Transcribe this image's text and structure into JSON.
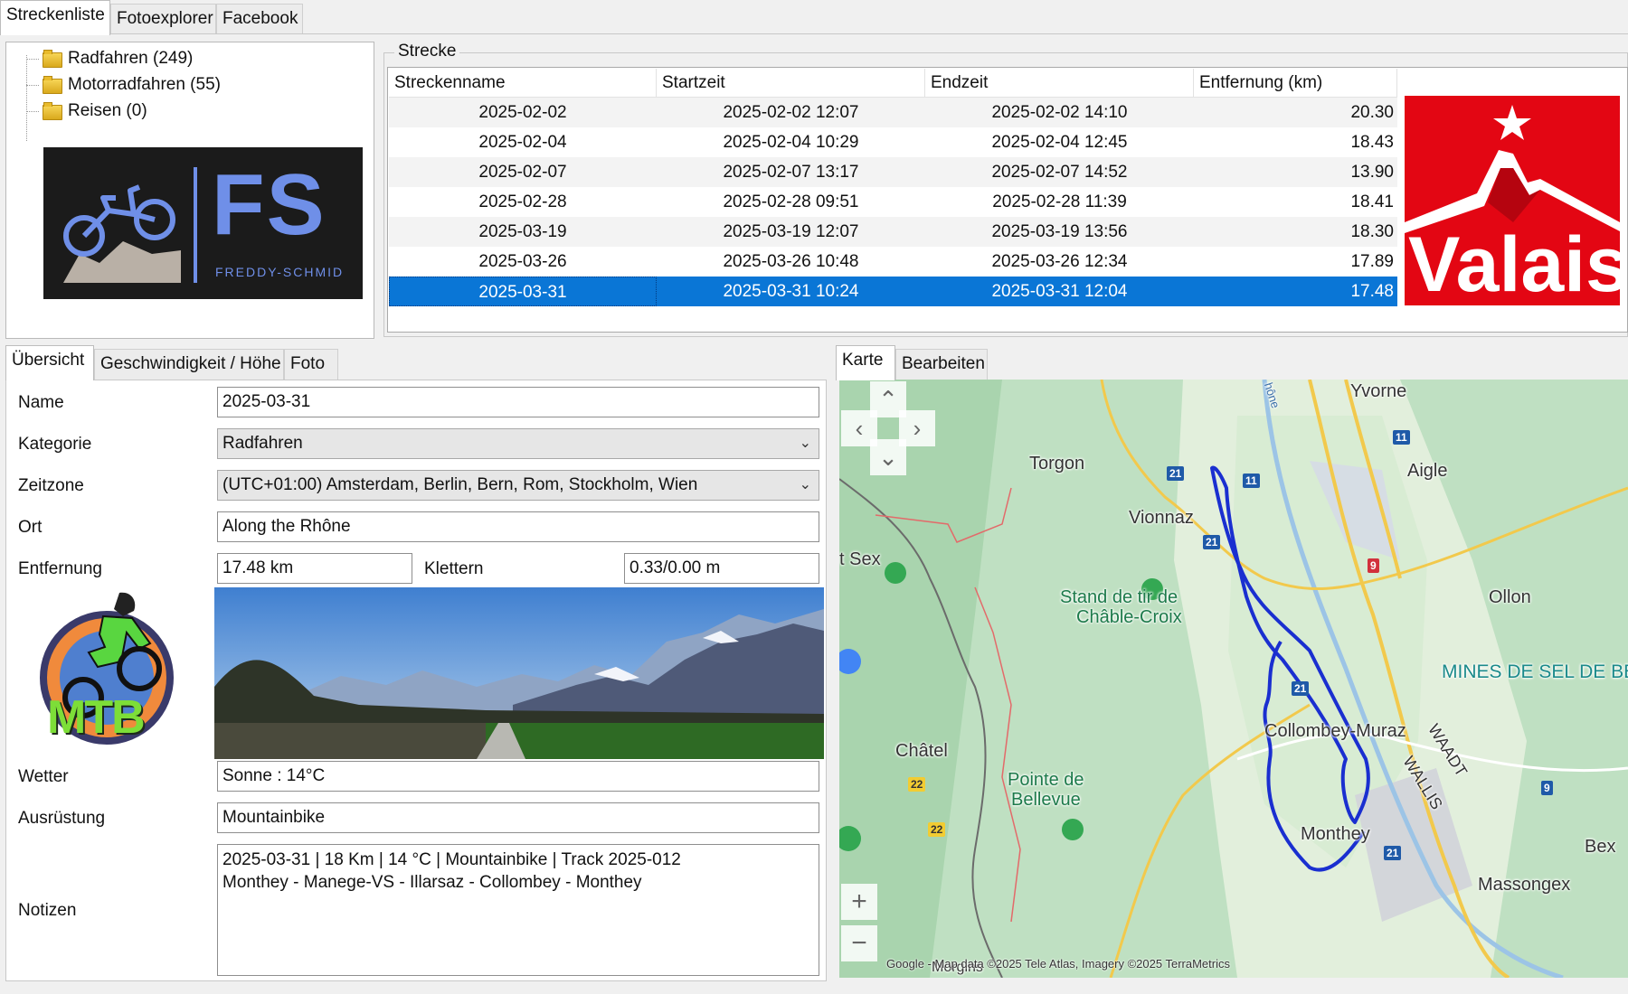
{
  "top_tabs": [
    "Streckenliste",
    "Fotoexplorer",
    "Facebook"
  ],
  "tree": [
    {
      "label": "Radfahren (249)"
    },
    {
      "label": "Motorradfahren (55)"
    },
    {
      "label": "Reisen (0)"
    }
  ],
  "logo_fs": {
    "big": "FS",
    "small": "FREDDY-SCHMID"
  },
  "strecke": {
    "group_label": "Strecke",
    "columns": [
      "Streckenname",
      "Startzeit",
      "Endzeit",
      "Entfernung (km)"
    ],
    "rows": [
      {
        "name": "2025-02-02",
        "start": "2025-02-02 12:07",
        "end": "2025-02-02 14:10",
        "dist": "20.30"
      },
      {
        "name": "2025-02-04",
        "start": "2025-02-04 10:29",
        "end": "2025-02-04 12:45",
        "dist": "18.43"
      },
      {
        "name": "2025-02-07",
        "start": "2025-02-07 13:17",
        "end": "2025-02-07 14:52",
        "dist": "13.90"
      },
      {
        "name": "2025-02-28",
        "start": "2025-02-28 09:51",
        "end": "2025-02-28 11:39",
        "dist": "18.41"
      },
      {
        "name": "2025-03-19",
        "start": "2025-03-19 12:07",
        "end": "2025-03-19 13:56",
        "dist": "18.30"
      },
      {
        "name": "2025-03-26",
        "start": "2025-03-26 10:48",
        "end": "2025-03-26 12:34",
        "dist": "17.89"
      },
      {
        "name": "2025-03-31",
        "start": "2025-03-31 10:24",
        "end": "2025-03-31 12:04",
        "dist": "17.48"
      }
    ],
    "selected_index": 6
  },
  "valais_logo": {
    "text": "Valais",
    "color": "#e30613"
  },
  "detail_tabs": [
    "Übersicht",
    "Geschwindigkeit / Höhe",
    "Foto"
  ],
  "form": {
    "name_label": "Name",
    "name_value": "2025-03-31",
    "kategorie_label": "Kategorie",
    "kategorie_value": "Radfahren",
    "zeitzone_label": "Zeitzone",
    "zeitzone_value": "(UTC+01:00) Amsterdam, Berlin, Bern, Rom, Stockholm, Wien",
    "ort_label": "Ort",
    "ort_value": "Along the Rhône",
    "entfernung_label": "Entfernung",
    "entfernung_value": "17.48 km",
    "klettern_label": "Klettern",
    "klettern_value": "0.33/0.00 m",
    "wetter_label": "Wetter",
    "wetter_value": "Sonne  :  14°C",
    "ausruestung_label": "Ausrüstung",
    "ausruestung_value": "Mountainbike",
    "notizen_label": "Notizen",
    "notizen_line1": "2025-03-31  |  18 Km  |  14 °C  |  Mountainbike  |  Track 2025-012",
    "notizen_line2": "Monthey - Manege-VS - Illarsaz - Collombey - Monthey"
  },
  "mtb_logo": {
    "text": "MTB"
  },
  "map_tabs": [
    "Karte",
    "Bearbeiten"
  ],
  "map": {
    "labels": [
      "Yvorne",
      "Aigle",
      "Torgon",
      "Vionnaz",
      "t Sex",
      "Stand de tir de",
      "Châble-Croix",
      "Ollon",
      "MINES DE SEL DE BEX",
      "Châtel",
      "Pointe de",
      "Bellevue",
      "Collombey-Muraz",
      "WAADT",
      "WALLIS",
      "Monthey",
      "Bex",
      "Massongex",
      "Morgins",
      "hône"
    ],
    "shields": [
      "11",
      "21",
      "11",
      "21",
      "9",
      "21",
      "22",
      "22",
      "21",
      "9"
    ],
    "copyright": "Google - Map data ©2025 Tele Atlas, Imagery ©2025 TerraMetrics",
    "zoom_in": "+",
    "zoom_out": "−"
  }
}
